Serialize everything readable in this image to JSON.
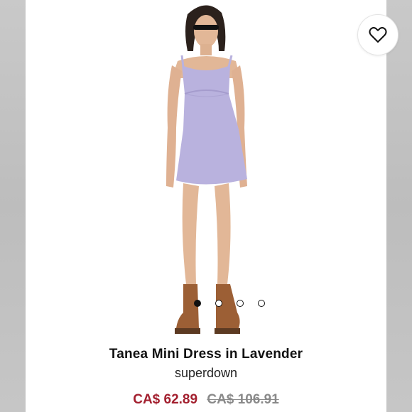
{
  "product": {
    "title": "Tanea Mini Dress in Lavender",
    "brand": "superdown",
    "price_sale": "CA$ 62.89",
    "price_original": "CA$ 106.91"
  },
  "gallery": {
    "image_count": 4,
    "active_index": 0
  },
  "icons": {
    "favorite": "heart-outline-icon"
  },
  "colors": {
    "sale_price": "#a3202f",
    "original_price": "#8a8a8a",
    "dress": "#b9b2de"
  }
}
